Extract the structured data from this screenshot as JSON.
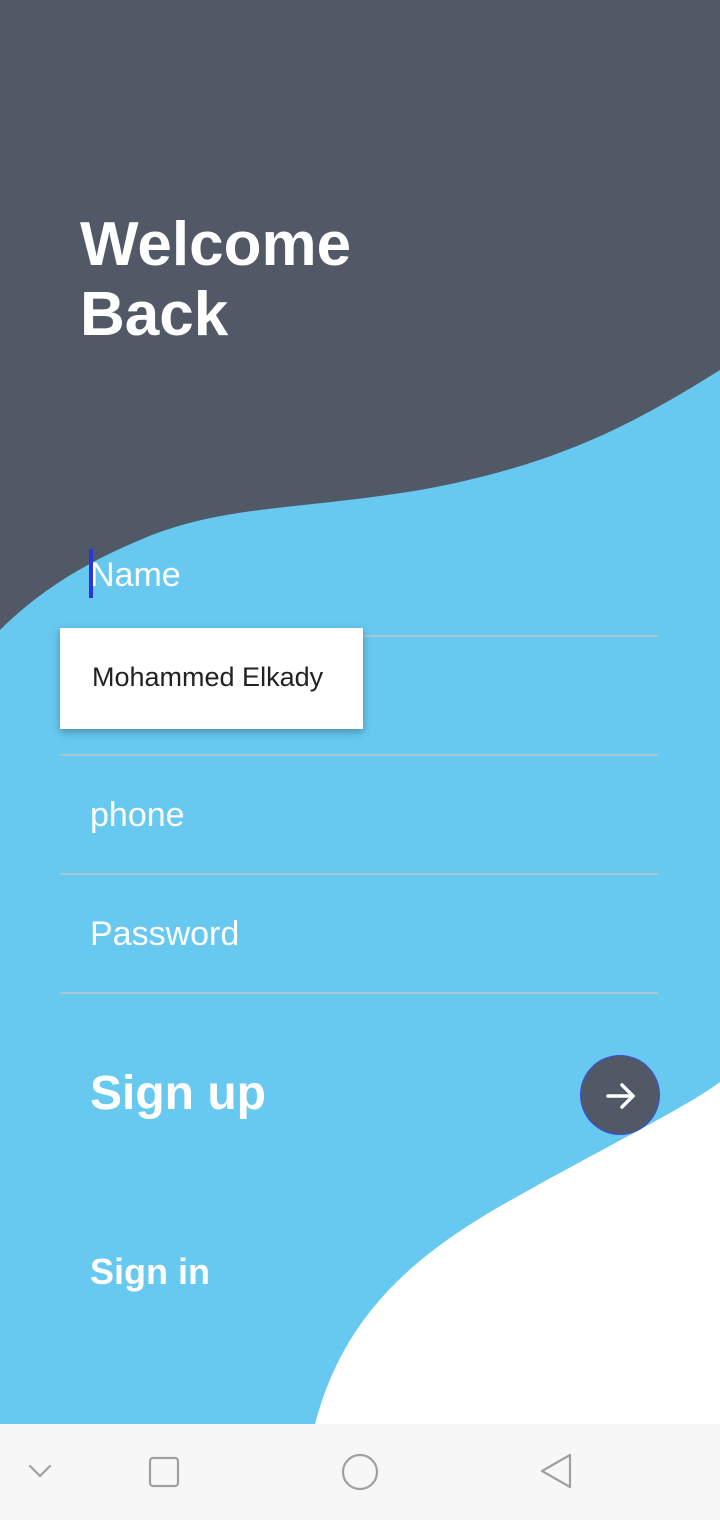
{
  "header": {
    "title_line1": "Welcome",
    "title_line2": "Back"
  },
  "form": {
    "name_placeholder": "Name",
    "name_value": "",
    "email_placeholder": "",
    "email_value": "",
    "phone_placeholder": "phone",
    "phone_value": "",
    "password_placeholder": "Password",
    "password_value": ""
  },
  "autofill": {
    "suggestion": "Mohammed Elkady"
  },
  "actions": {
    "signup_label": "Sign up",
    "signin_label": "Sign in",
    "go_icon": "arrow-right-icon"
  },
  "navbar": {
    "icons": [
      "chevron-down-icon",
      "recent-apps-icon",
      "home-icon",
      "back-icon"
    ]
  },
  "colors": {
    "dark_panel": "#515866",
    "accent_blue": "#67c9f0",
    "white_panel": "#ffffff",
    "caret": "#2c36d6"
  }
}
